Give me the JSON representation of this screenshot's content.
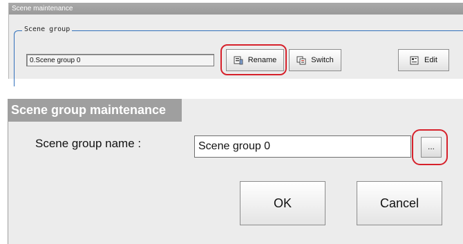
{
  "scene_maintenance": {
    "title": "Scene maintenance",
    "group_legend": "Scene group",
    "group_value": "0.Scene group 0",
    "buttons": {
      "rename": "Rename",
      "switch": "Switch",
      "edit": "Edit"
    },
    "icons": {
      "rename": "rename-icon",
      "switch": "switch-icon",
      "edit": "edit-icon"
    }
  },
  "scene_group_maintenance": {
    "title": "Scene group maintenance",
    "name_label": "Scene group name :",
    "name_value": "Scene group 0",
    "browse_label": "...",
    "ok_label": "OK",
    "cancel_label": "Cancel"
  },
  "colors": {
    "highlight": "#d6202a",
    "group_border": "#2f6fba",
    "titlebar": "#9f9f9f",
    "panel": "#ececec"
  }
}
